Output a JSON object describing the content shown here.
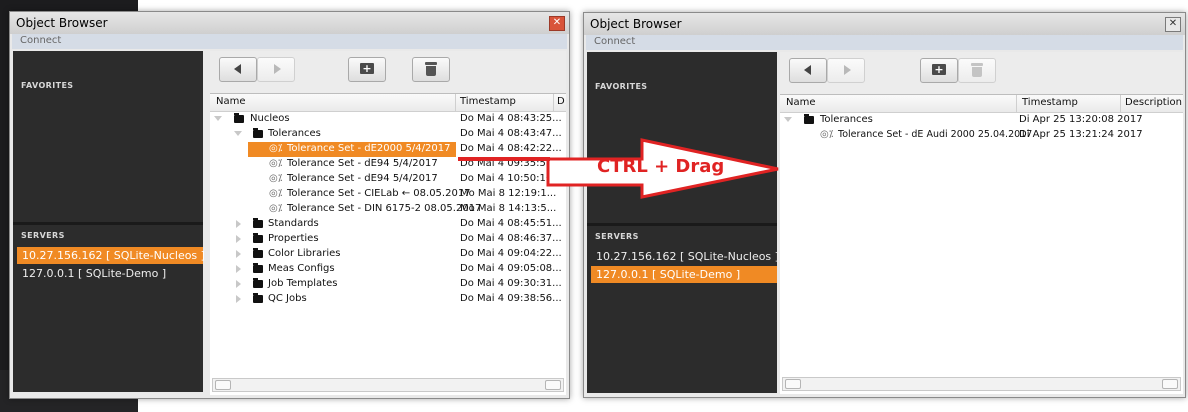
{
  "left_window": {
    "title": "Object Browser",
    "close_glyph": "✕",
    "menu": "Connect",
    "sidebar": {
      "favorites_label": "FAVORITES",
      "servers_label": "SERVERS",
      "servers": [
        {
          "label": "10.27.156.162 [ SQLite-Nucleos ]"
        },
        {
          "label": "127.0.0.1 [ SQLite-Demo ]"
        }
      ]
    },
    "columns": {
      "name": "Name",
      "timestamp": "Timestamp",
      "description": "D"
    },
    "rows": [
      {
        "name": "Nucleos",
        "ts": "Do Mai 4 08:43:25..."
      },
      {
        "name": "Tolerances",
        "ts": "Do Mai 4 08:43:47..."
      },
      {
        "name": "Tolerance Set - dE2000 5/4/2017",
        "ts": "Do Mai 4 08:42:22..."
      },
      {
        "name": "Tolerance Set - dE94 5/4/2017",
        "ts": "Do Mai 4 09:35:55..."
      },
      {
        "name": "Tolerance Set - dE94 5/4/2017",
        "ts": "Do Mai 4 10:50:10..."
      },
      {
        "name": "Tolerance Set - CIELab ← 08.05.2017",
        "ts": "Mo Mai 8 12:19:1..."
      },
      {
        "name": "Tolerance Set - DIN 6175-2 08.05.2017",
        "ts": "Mo Mai 8 14:13:5..."
      },
      {
        "name": "Standards",
        "ts": "Do Mai 4 08:45:51..."
      },
      {
        "name": "Properties",
        "ts": "Do Mai 4 08:46:37..."
      },
      {
        "name": "Color Libraries",
        "ts": "Do Mai 4 09:04:22..."
      },
      {
        "name": "Meas Configs",
        "ts": "Do Mai 4 09:05:08..."
      },
      {
        "name": "Job Templates",
        "ts": "Do Mai 4 09:30:31..."
      },
      {
        "name": "QC Jobs",
        "ts": "Do Mai 4 09:38:56..."
      }
    ],
    "tolerance_glyph": "◎⁒"
  },
  "right_window": {
    "title": "Object Browser",
    "close_glyph": "✕",
    "menu": "Connect",
    "sidebar": {
      "favorites_label": "FAVORITES",
      "servers_label": "SERVERS",
      "servers": [
        {
          "label": "10.27.156.162 [ SQLite-Nucleos ]"
        },
        {
          "label": "127.0.0.1 [ SQLite-Demo ]"
        }
      ]
    },
    "columns": {
      "name": "Name",
      "timestamp": "Timestamp",
      "description": "Description"
    },
    "rows": [
      {
        "name": "Tolerances",
        "ts": "Di Apr 25 13:20:08 2017"
      },
      {
        "name": "Tolerance Set - dE Audi 2000 25.04.2017",
        "ts": "Di Apr 25 13:21:24 2017"
      }
    ],
    "tolerance_glyph": "◎⁒"
  },
  "annotation": {
    "text": "CTRL + Drag",
    "color": "#e02323"
  },
  "colors": {
    "selection": "#f08a24",
    "sidebar": "#2c2c2c"
  }
}
